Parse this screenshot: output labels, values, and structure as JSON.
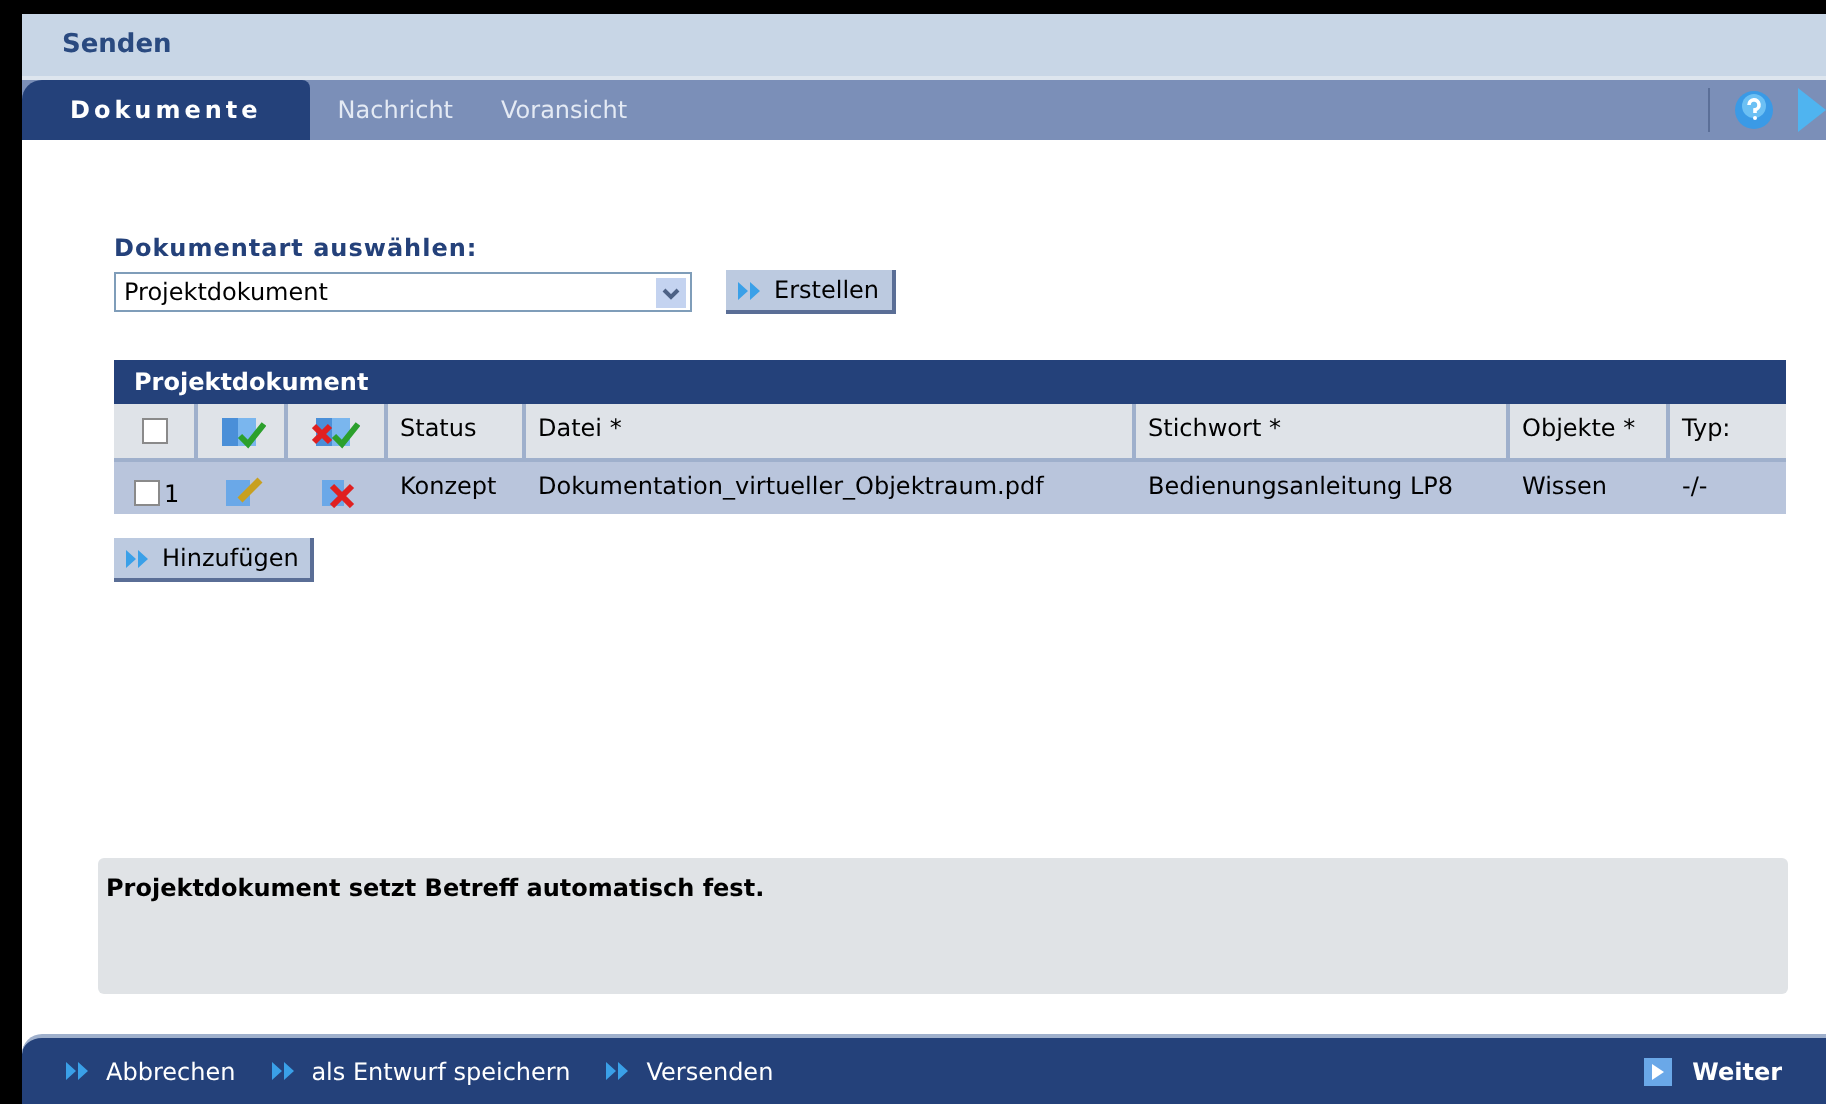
{
  "window": {
    "title": "Senden"
  },
  "tabs": [
    {
      "label": "Dokumente",
      "selected": true
    },
    {
      "label": "Nachricht",
      "selected": false
    },
    {
      "label": "Voransicht",
      "selected": false
    }
  ],
  "doc_type": {
    "label": "Dokumentart auswählen:",
    "value": "Projektdokument",
    "button": "Erstellen"
  },
  "table": {
    "title": "Projektdokument",
    "select_all_checked": false,
    "columns": [
      "Status",
      "Datei *",
      "Stichwort *",
      "Objekte *",
      "Typ:"
    ],
    "rows": [
      {
        "checked": false,
        "number": "1",
        "cells": [
          "Konzept",
          "Dokumentation_virtueller_Objektraum.pdf",
          "Bedienungsanleitung LP8",
          "Wissen",
          "-/-"
        ]
      }
    ]
  },
  "add_button": "Hinzufügen",
  "note": "Projektdokument setzt Betreff automatisch fest.",
  "footer": {
    "actions": [
      "Abbrechen",
      "als Entwurf speichern",
      "Versenden"
    ],
    "next": "Weiter"
  }
}
